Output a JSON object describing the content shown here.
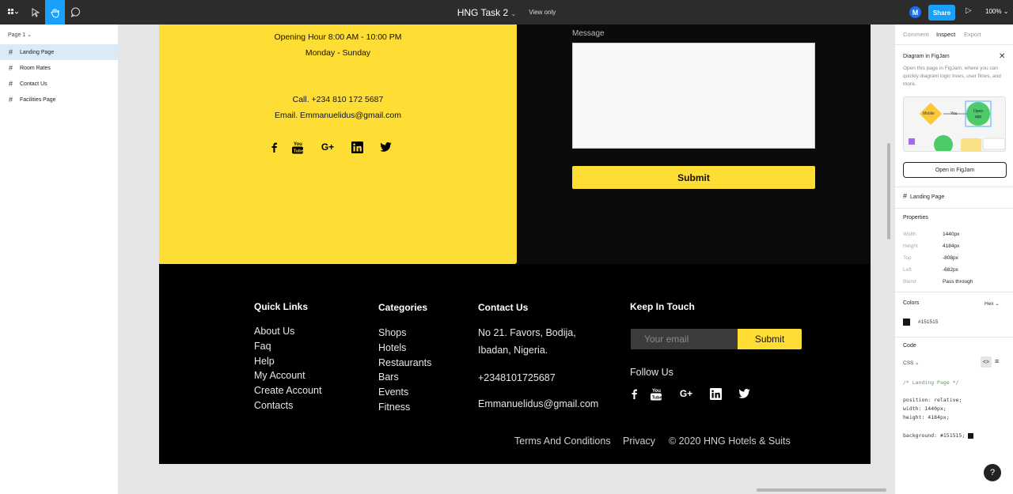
{
  "toolbar": {
    "file_name": "HNG Task 2",
    "view_mode": "View only",
    "avatar_initial": "M",
    "share_label": "Share",
    "zoom": "100%"
  },
  "layers": {
    "page_label": "Page 1",
    "items": [
      "Landing Page",
      "Room Rates",
      "Contact Us",
      "Facilities Page"
    ]
  },
  "contact_card": {
    "hours": "Opening Hour 8:00 AM - 10:00 PM",
    "days": "Monday - Sunday",
    "phone": "Call. +234 810 172 5687",
    "email": "Email. Emmanuelidus@gmail.com",
    "social_icons": [
      "facebook-icon",
      "youtube-icon",
      "google-plus-icon",
      "linkedin-icon",
      "twitter-icon"
    ]
  },
  "form": {
    "message_label": "Message",
    "submit_label": "Submit"
  },
  "footer": {
    "quick_links_title": "Quick Links",
    "quick_links": [
      "About Us",
      "Faq",
      "Help",
      "My Account",
      "Create Account",
      "Contacts"
    ],
    "categories_title": "Categories",
    "categories": [
      "Shops",
      "Hotels",
      "Restaurants",
      "Bars",
      "Events",
      "Fitness"
    ],
    "contact_title": "Contact Us",
    "address_line1": "No 21. Favors, Bodija,",
    "address_line2": "Ibadan, Nigeria.",
    "phone": "+2348101725687",
    "email": "Emmanuelidus@gmail.com",
    "keep_title": "Keep In Touch",
    "email_placeholder": "Your email",
    "email_submit": "Submit",
    "follow_title": "Follow Us",
    "terms": "Terms And Conditions",
    "privacy": "Privacy",
    "copyright": "© 2020 HNG Hotels & Suits"
  },
  "right_panel": {
    "tabs": [
      "Comment",
      "Inspect",
      "Export"
    ],
    "diagram_title": "Diagram in FigJam",
    "diagram_text": "Open this page in FigJam, where you can quickly diagram logic trees, user flows, and more.",
    "diagram_labels": [
      "Mobile",
      "You",
      "Open app"
    ],
    "open_button": "Open in FigJam",
    "selected_layer": "Landing Page",
    "properties_title": "Properties",
    "props": [
      {
        "k": "Width",
        "v": "1440px"
      },
      {
        "k": "Height",
        "v": "4184px"
      },
      {
        "k": "Top",
        "v": "-808px"
      },
      {
        "k": "Left",
        "v": "-682px"
      },
      {
        "k": "Blend",
        "v": "Pass through"
      }
    ],
    "colors_title": "Colors",
    "color_format": "Hex",
    "color_value": "#151515",
    "code_title": "Code",
    "code_lang": "CSS",
    "code_comment": "/* Landing Page */",
    "code_position": "position: relative;",
    "code_width": "width: 1440px;",
    "code_height": "height: 4184px;",
    "code_background": "background: #151515;"
  },
  "colors": {
    "brand_yellow": "#fedd35",
    "figma_blue": "#18a0fb",
    "swatch": "#151515"
  }
}
